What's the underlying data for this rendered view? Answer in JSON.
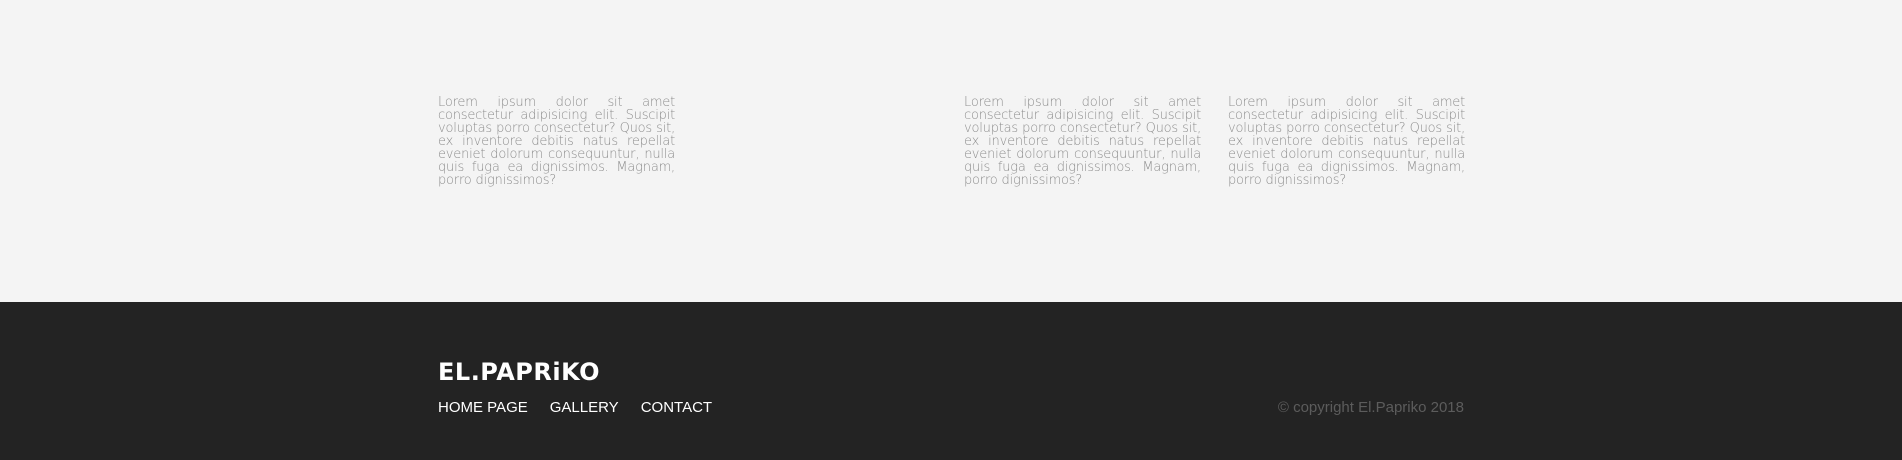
{
  "content": {
    "paragraphs": [
      "Lorem ipsum dolor sit amet consectetur adipisicing elit. Suscipit voluptas porro consectetur? Quos sit, ex inventore debitis natus repellat eveniet dolorum consequuntur, nulla quis fuga ea dignissimos. Magnam, porro dignissimos?",
      "Lorem ipsum dolor sit amet consectetur adipisicing elit. Suscipit voluptas porro consectetur? Quos sit, ex inventore debitis natus repellat eveniet dolorum consequuntur, nulla quis fuga ea dignissimos. Magnam, porro dignissimos?",
      "Lorem ipsum dolor sit amet consectetur adipisicing elit. Suscipit voluptas porro consectetur? Quos sit, ex inventore debitis natus repellat eveniet dolorum consequuntur, nulla quis fuga ea dignissimos. Magnam, porro dignissimos?"
    ]
  },
  "footer": {
    "logo": "EL.PAPRiKO",
    "nav": [
      "HOME PAGE",
      "GALLERY",
      "CONTACT"
    ],
    "copyright": "© copyright El.Papriko 2018"
  },
  "colors": {
    "page_background": "#f4f4f4",
    "footer_background": "#232323",
    "body_text": "#8e8e8e",
    "copyright_text": "#5c5c5c"
  }
}
